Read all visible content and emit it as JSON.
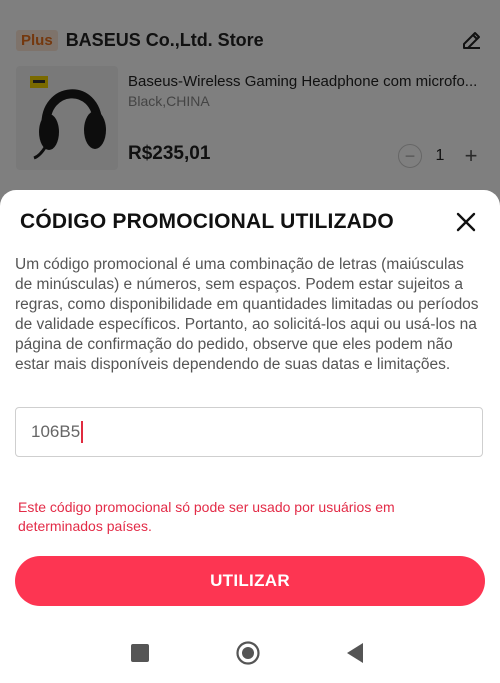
{
  "store": {
    "badge": "Plus",
    "name": "BASEUS Co.,Ltd. Store",
    "edit_icon": "pencil-icon"
  },
  "product": {
    "title": "Baseus-Wireless Gaming Headphone com microfo...",
    "variant": "Black,CHINA",
    "price": "R$235,01",
    "quantity": "1",
    "decrease_icon": "minus-icon",
    "increase_icon": "plus-icon"
  },
  "sheet": {
    "title": "CÓDIGO PROMOCIONAL UTILIZADO",
    "close_icon": "close-icon",
    "description": "Um código promocional é uma combinação de letras (maiúsculas de minúsculas) e números, sem espaços. Podem estar sujeitos a regras, como disponibilidade em quantidades limitadas ou períodos de validade específicos. Portanto, ao solicitá-los aqui ou usá-los na página de confirmação do pedido, observe que eles podem não estar mais disponíveis dependendo de suas datas e limitações.",
    "code_value": "106B5",
    "error": "Este código promocional só pode ser usado por usuários em determinados países.",
    "apply_label": "UTILIZAR"
  },
  "colors": {
    "accent": "#fd3552",
    "error": "#e32b47",
    "badge_text": "#e8711d"
  },
  "navbar": {
    "recent_icon": "square-icon",
    "home_icon": "circle-home-icon",
    "back_icon": "triangle-back-icon"
  }
}
